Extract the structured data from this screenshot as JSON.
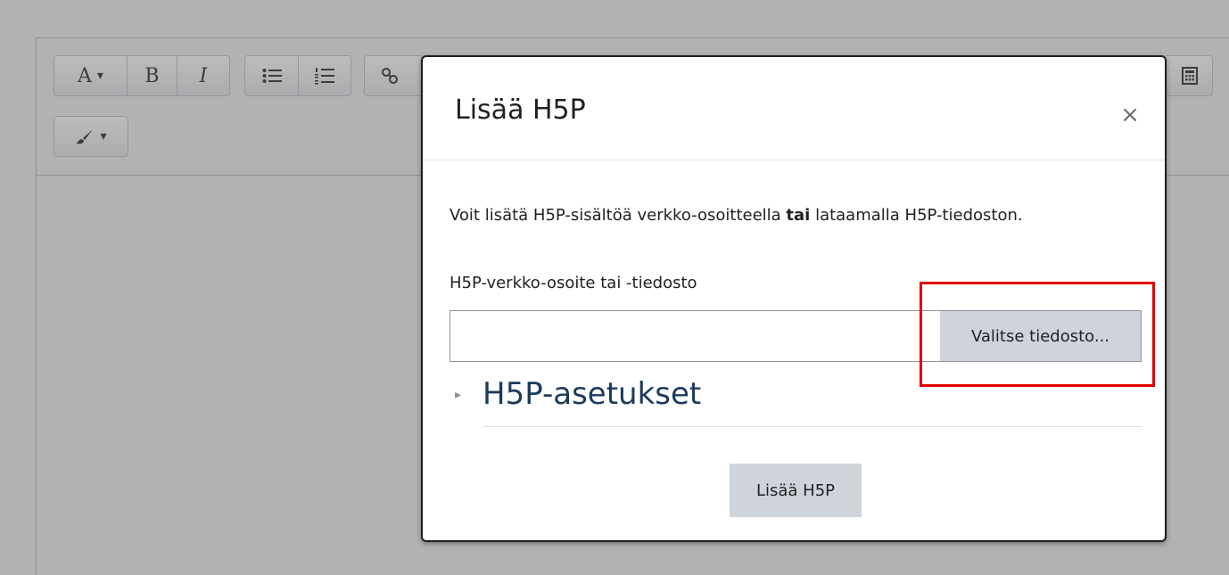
{
  "toolbar": {
    "font_style_glyph": "A",
    "dropdown_glyph": "▾",
    "bold_glyph": "B",
    "italic_glyph": "I"
  },
  "modal": {
    "title": "Lisää H5P",
    "close_glyph": "×",
    "intro_before": "Voit lisätä H5P-sisältöä verkko-osoitteella ",
    "intro_bold": "tai",
    "intro_after": " lataamalla H5P-tiedoston.",
    "field_label": "H5P-verkko-osoite tai -tiedosto",
    "url_value": "",
    "choose_file_label": "Valitse tiedosto...",
    "settings_caret": "▸",
    "settings_title": "H5P-asetukset",
    "submit_label": "Lisää H5P"
  },
  "colors": {
    "highlight": "#e00000",
    "settings_title": "#1a3b5c",
    "button_bg": "#ced4da"
  }
}
